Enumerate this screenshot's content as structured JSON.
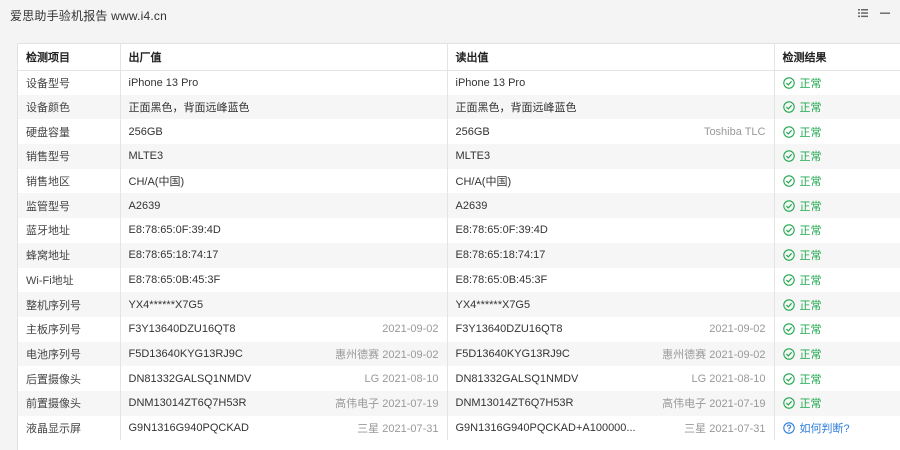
{
  "window": {
    "title": "爱思助手验机报告 www.i4.cn"
  },
  "table": {
    "headers": [
      "检测项目",
      "出厂值",
      "读出值",
      "检测结果"
    ],
    "rows": [
      {
        "item": "设备型号",
        "factory": "iPhone 13 Pro",
        "factory_meta": "",
        "read": "iPhone 13 Pro",
        "read_meta": "",
        "result": "正常",
        "status": "ok"
      },
      {
        "item": "设备颜色",
        "factory": "正面黑色，背面远峰蓝色",
        "factory_meta": "",
        "read": "正面黑色，背面远峰蓝色",
        "read_meta": "",
        "result": "正常",
        "status": "ok"
      },
      {
        "item": "硬盘容量",
        "factory": "256GB",
        "factory_meta": "",
        "read": "256GB",
        "read_meta": "Toshiba TLC",
        "result": "正常",
        "status": "ok"
      },
      {
        "item": "销售型号",
        "factory": "MLTE3",
        "factory_meta": "",
        "read": "MLTE3",
        "read_meta": "",
        "result": "正常",
        "status": "ok"
      },
      {
        "item": "销售地区",
        "factory": "CH/A(中国)",
        "factory_meta": "",
        "read": "CH/A(中国)",
        "read_meta": "",
        "result": "正常",
        "status": "ok"
      },
      {
        "item": "监管型号",
        "factory": "A2639",
        "factory_meta": "",
        "read": "A2639",
        "read_meta": "",
        "result": "正常",
        "status": "ok"
      },
      {
        "item": "蓝牙地址",
        "factory": "E8:78:65:0F:39:4D",
        "factory_meta": "",
        "read": "E8:78:65:0F:39:4D",
        "read_meta": "",
        "result": "正常",
        "status": "ok"
      },
      {
        "item": "蜂窝地址",
        "factory": "E8:78:65:18:74:17",
        "factory_meta": "",
        "read": "E8:78:65:18:74:17",
        "read_meta": "",
        "result": "正常",
        "status": "ok"
      },
      {
        "item": "Wi-Fi地址",
        "factory": "E8:78:65:0B:45:3F",
        "factory_meta": "",
        "read": "E8:78:65:0B:45:3F",
        "read_meta": "",
        "result": "正常",
        "status": "ok"
      },
      {
        "item": "整机序列号",
        "factory": "YX4******X7G5",
        "factory_meta": "",
        "read": "YX4******X7G5",
        "read_meta": "",
        "result": "正常",
        "status": "ok"
      },
      {
        "item": "主板序列号",
        "factory": "F3Y13640DZU16QT8",
        "factory_meta": "2021-09-02",
        "read": "F3Y13640DZU16QT8",
        "read_meta": "2021-09-02",
        "result": "正常",
        "status": "ok"
      },
      {
        "item": "电池序列号",
        "factory": "F5D13640KYG13RJ9C",
        "factory_meta": "惠州德赛 2021-09-02",
        "read": "F5D13640KYG13RJ9C",
        "read_meta": "惠州德赛 2021-09-02",
        "result": "正常",
        "status": "ok"
      },
      {
        "item": "后置摄像头",
        "factory": "DN81332GALSQ1NMDV",
        "factory_meta": "LG 2021-08-10",
        "read": "DN81332GALSQ1NMDV",
        "read_meta": "LG 2021-08-10",
        "result": "正常",
        "status": "ok"
      },
      {
        "item": "前置摄像头",
        "factory": "DNM13014ZT6Q7H53R",
        "factory_meta": "高伟电子 2021-07-19",
        "read": "DNM13014ZT6Q7H53R",
        "read_meta": "高伟电子 2021-07-19",
        "result": "正常",
        "status": "ok"
      },
      {
        "item": "液晶显示屏",
        "factory": "G9N1316G940PQCKAD",
        "factory_meta": "三星 2021-07-31",
        "read": "G9N1316G940PQCKAD+A100000...",
        "read_meta": "三星 2021-07-31",
        "result": "如何判断?",
        "status": "question"
      }
    ]
  },
  "colors": {
    "ok": "#1fa84f",
    "question": "#2d7ddc"
  },
  "icons": {
    "ok": "check-circle-icon",
    "question": "question-circle-icon",
    "titlebar": [
      "list-icon",
      "minimize-icon"
    ]
  }
}
